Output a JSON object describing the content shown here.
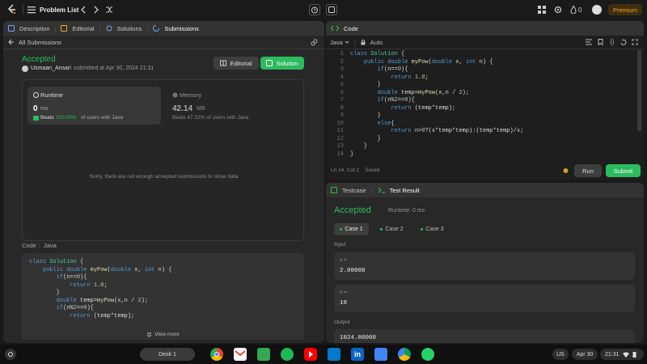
{
  "topbar": {
    "problem_list": "Problem List",
    "premium": "Premium",
    "streak": "0"
  },
  "left_tabs": {
    "description": "Description",
    "editorial": "Editorial",
    "solutions": "Solutions",
    "submissions": "Submissions",
    "all_submissions": "All Submissions"
  },
  "submission": {
    "status": "Accepted",
    "user": "Usmaan_Ansari",
    "submitted_text": "submitted at Apr 30, 2024 21:31",
    "editorial_btn": "Editorial",
    "solution_btn": "Solution",
    "runtime_label": "Runtime",
    "runtime_value": "0",
    "runtime_unit": "ms",
    "runtime_beats_prefix": "Beats",
    "runtime_beats_pct": "100.00%",
    "runtime_beats_suffix": "of users with Java",
    "memory_label": "Memory",
    "memory_value": "42.14",
    "memory_unit": "MB",
    "memory_beats": "Beats 47.32% of users with Java",
    "empty_msg": "Sorry, there are not enough accepted submissions to show data",
    "code_label": "Code",
    "code_lang": "Java",
    "view_more": "View more"
  },
  "editor": {
    "title": "Code",
    "language": "Java",
    "auto": "Auto",
    "status": "Ln 14, Col 2",
    "saved": "Saved",
    "run": "Run",
    "submit": "Submit"
  },
  "testpanel": {
    "testcase_tab": "Testcase",
    "result_tab": "Test Result",
    "status": "Accepted",
    "runtime": "Runtime: 0 ms",
    "cases": [
      "Case 1",
      "Case 2",
      "Case 3"
    ],
    "input_label": "Input",
    "x_label": "x =",
    "x_value": "2.00000",
    "n_label": "n =",
    "n_value": "10",
    "output_label": "Output",
    "output_value": "1024.00000"
  },
  "taskbar": {
    "desk": "Desk 1",
    "locale": "US",
    "date": "Apr 30",
    "time": "21:31"
  },
  "colors": {
    "accent_green": "#2cbb5d",
    "premium": "#ffa116",
    "editor_bg": "#1e1e1e"
  }
}
